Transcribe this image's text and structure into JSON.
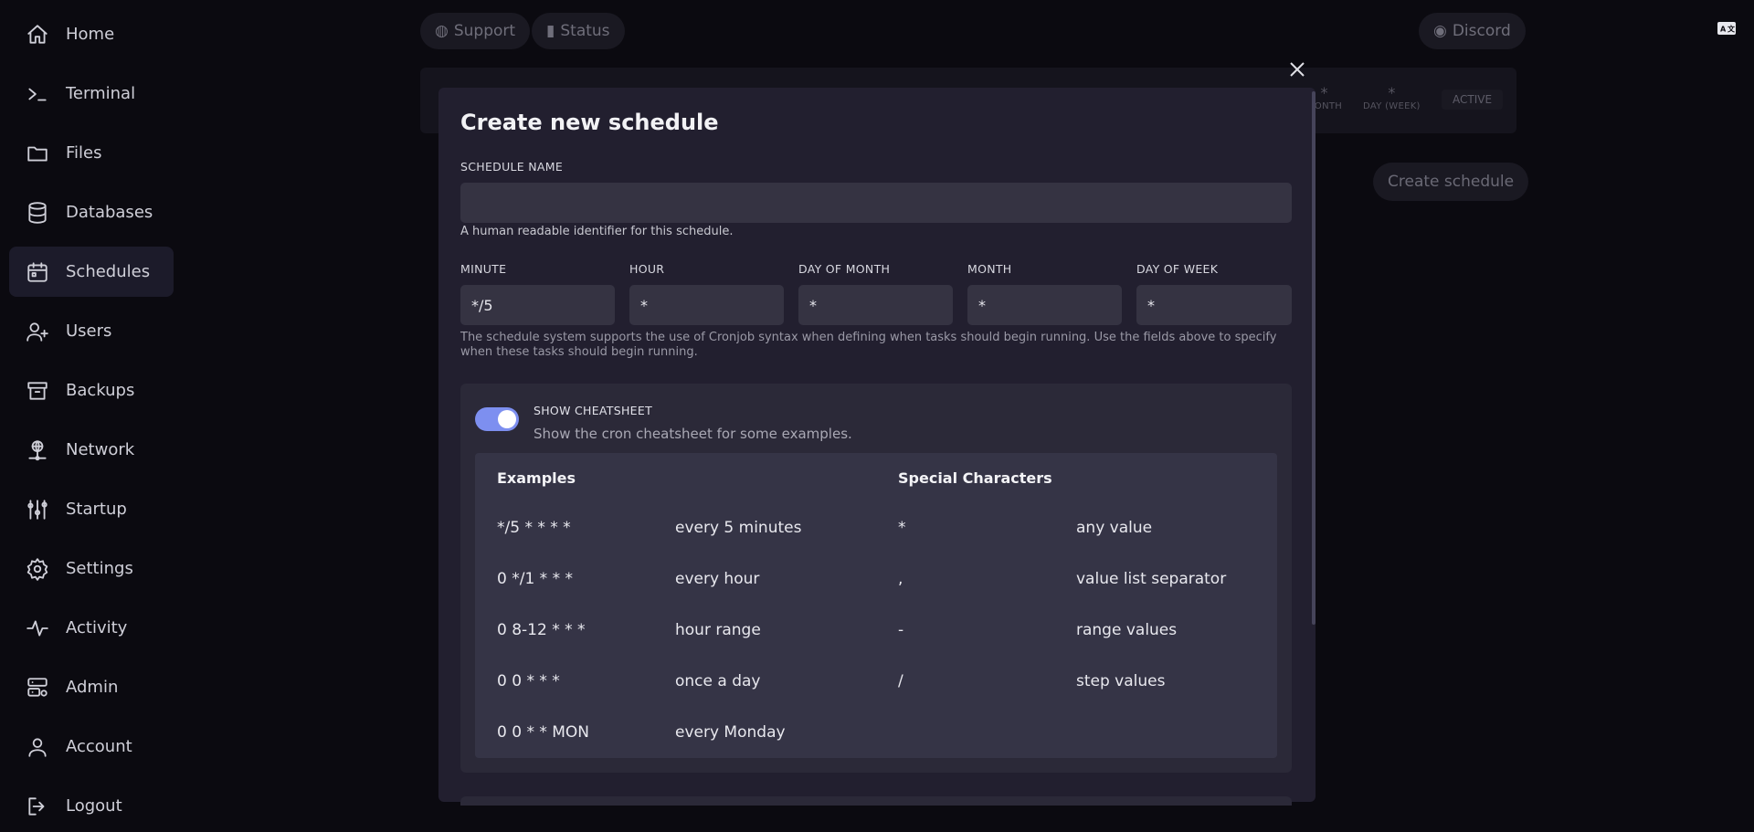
{
  "sidebar": {
    "items": [
      {
        "label": "Home",
        "icon": "home-icon"
      },
      {
        "label": "Terminal",
        "icon": "terminal-icon"
      },
      {
        "label": "Files",
        "icon": "folder-icon"
      },
      {
        "label": "Databases",
        "icon": "database-icon"
      },
      {
        "label": "Schedules",
        "icon": "calendar-icon",
        "active": true
      },
      {
        "label": "Users",
        "icon": "users-icon"
      },
      {
        "label": "Backups",
        "icon": "archive-icon"
      },
      {
        "label": "Network",
        "icon": "network-icon"
      },
      {
        "label": "Startup",
        "icon": "sliders-icon"
      },
      {
        "label": "Settings",
        "icon": "gear-icon"
      },
      {
        "label": "Activity",
        "icon": "activity-icon"
      },
      {
        "label": "Admin",
        "icon": "server-cog-icon"
      },
      {
        "label": "Account",
        "icon": "user-icon"
      },
      {
        "label": "Logout",
        "icon": "logout-icon"
      }
    ]
  },
  "header": {
    "support_label": "Support",
    "status_label": "Status",
    "discord_label": "Discord"
  },
  "background_schedule": {
    "month_value": "*",
    "month_label": "MONTH",
    "dow_value": "*",
    "dow_label": "DAY (WEEK)",
    "status": "ACTIVE"
  },
  "background_create_label": "Create schedule",
  "modal": {
    "title": "Create new schedule",
    "name_label": "SCHEDULE NAME",
    "name_value": "",
    "name_help": "A human readable identifier for this schedule.",
    "cron_fields": [
      {
        "label": "MINUTE",
        "value": "*/5"
      },
      {
        "label": "HOUR",
        "value": "*"
      },
      {
        "label": "DAY OF MONTH",
        "value": "*"
      },
      {
        "label": "MONTH",
        "value": "*"
      },
      {
        "label": "DAY OF WEEK",
        "value": "*"
      }
    ],
    "cron_help": "The schedule system supports the use of Cronjob syntax when defining when tasks should begin running. Use the fields above to specify when these tasks should begin running.",
    "cheatsheet": {
      "toggle_title": "SHOW CHEATSHEET",
      "toggle_desc": "Show the cron cheatsheet for some examples.",
      "toggle_on": true,
      "examples_heading": "Examples",
      "special_heading": "Special Characters",
      "examples": [
        {
          "expr": "*/5 * * * *",
          "desc": "every 5 minutes"
        },
        {
          "expr": "0 */1 * * *",
          "desc": "every hour"
        },
        {
          "expr": "0 8-12 * * *",
          "desc": "hour range"
        },
        {
          "expr": "0 0 * * *",
          "desc": "once a day"
        },
        {
          "expr": "0 0 * * MON",
          "desc": "every Monday"
        }
      ],
      "specials": [
        {
          "char": "*",
          "desc": "any value"
        },
        {
          "char": ",",
          "desc": "value list separator"
        },
        {
          "char": "-",
          "desc": "range values"
        },
        {
          "char": "/",
          "desc": "step values"
        }
      ]
    }
  },
  "colors": {
    "accent": "#7d8ff0",
    "modal_bg": "#221f2f",
    "input_bg": "#353342"
  }
}
